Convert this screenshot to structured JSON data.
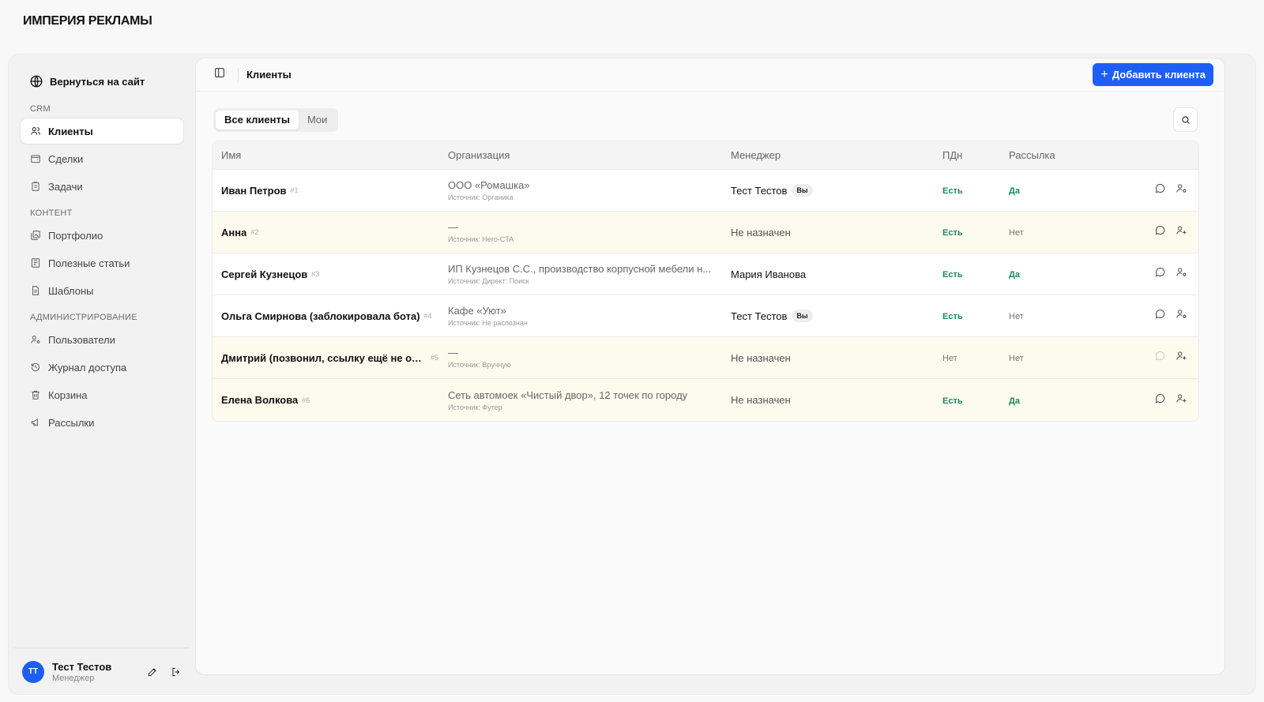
{
  "brand": "ИМПЕРИЯ РЕКЛАМЫ",
  "sidebar": {
    "back_label": "Вернуться на сайт",
    "sections": [
      {
        "title": "CRM",
        "items": [
          {
            "label": "Клиенты",
            "icon": "users-icon",
            "active": true
          },
          {
            "label": "Сделки",
            "icon": "wallet-icon",
            "active": false
          },
          {
            "label": "Задачи",
            "icon": "clipboard-icon",
            "active": false
          }
        ]
      },
      {
        "title": "КОНТЕНТ",
        "items": [
          {
            "label": "Портфолио",
            "icon": "gallery-icon",
            "active": false
          },
          {
            "label": "Полезные статьи",
            "icon": "newspaper-icon",
            "active": false
          },
          {
            "label": "Шаблоны",
            "icon": "document-icon",
            "active": false
          }
        ]
      },
      {
        "title": "АДМИНИСТРИРОВАНИЕ",
        "items": [
          {
            "label": "Пользователи",
            "icon": "user-cog-icon",
            "active": false
          },
          {
            "label": "Журнал доступа",
            "icon": "history-icon",
            "active": false
          },
          {
            "label": "Корзина",
            "icon": "trash-icon",
            "active": false
          },
          {
            "label": "Рассылки",
            "icon": "megaphone-icon",
            "active": false
          }
        ]
      }
    ],
    "user": {
      "initials": "ТТ",
      "name": "Тест Тестов",
      "role": "Менеджер"
    }
  },
  "header": {
    "title": "Клиенты",
    "add_button": "Добавить клиента"
  },
  "tabs": [
    {
      "label": "Все клиенты",
      "active": true
    },
    {
      "label": "Мои",
      "active": false
    }
  ],
  "table": {
    "columns": [
      "Имя",
      "Организация",
      "Менеджер",
      "ПДн",
      "Рассылка"
    ],
    "rows": [
      {
        "name": "Иван Петров",
        "num": "#1",
        "org": "ООО «Ромашка»",
        "source": "Источник: Органика",
        "manager": "Тест Тестов",
        "you": "Вы",
        "pdn": "Есть",
        "mail": "Да",
        "highlight": false
      },
      {
        "name": "Анна",
        "num": "#2",
        "org": "—",
        "source": "Источник: Hero-CTA",
        "manager": "Не назначен",
        "you": "",
        "pdn": "Есть",
        "mail": "Нет",
        "highlight": true
      },
      {
        "name": "Сергей Кузнецов",
        "num": "#3",
        "org": "ИП Кузнецов С.С., производство корпусной мебели н...",
        "source": "Источник: Директ: Поиск",
        "manager": "Мария Иванова",
        "you": "",
        "pdn": "Есть",
        "mail": "Да",
        "highlight": false
      },
      {
        "name": "Ольга Смирнова (заблокировала бота)",
        "num": "#4",
        "org": "Кафе «Уют»",
        "source": "Источник: Не распознан",
        "manager": "Тест Тестов",
        "you": "Вы",
        "pdn": "Есть",
        "mail": "Нет",
        "highlight": false
      },
      {
        "name": "Дмитрий (позвонил, ссылку ещё не откр...",
        "num": "#5",
        "org": "—",
        "source": "Источник: Вручную",
        "manager": "Не назначен",
        "you": "",
        "pdn": "Нет",
        "mail": "Нет",
        "highlight": true
      },
      {
        "name": "Елена Волкова",
        "num": "#6",
        "org": "Сеть автомоек «Чистый двор», 12 точек по городу",
        "source": "Источник: Футер",
        "manager": "Не назначен",
        "you": "",
        "pdn": "Есть",
        "mail": "Да",
        "highlight": true
      }
    ]
  }
}
